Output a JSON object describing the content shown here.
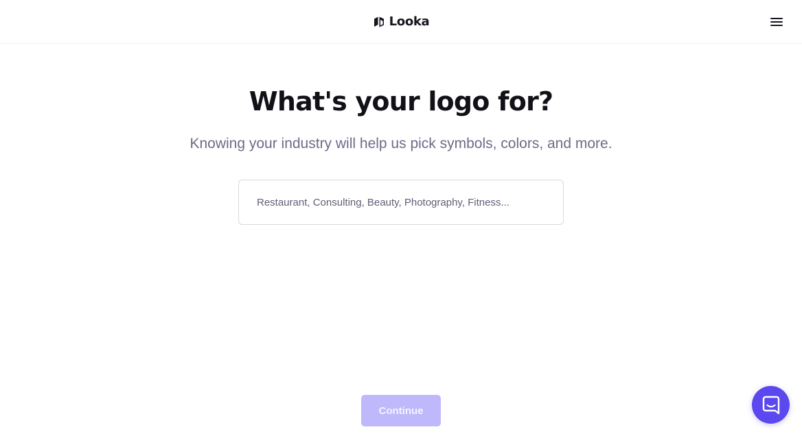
{
  "header": {
    "brand_name": "Looka",
    "logo_icon": "looka-logo-icon",
    "menu_icon": "hamburger-menu-icon"
  },
  "main": {
    "title": "What's your logo for?",
    "subtitle": "Knowing your industry will help us pick symbols, colors, and more.",
    "industry_input": {
      "value": "",
      "placeholder": "Restaurant, Consulting, Beauty, Photography, Fitness..."
    },
    "continue_label": "Continue",
    "continue_disabled": true
  },
  "chat": {
    "icon": "chat-bubble-icon"
  },
  "colors": {
    "accent": "#5b48ee",
    "button_disabled_bg": "#bfb8fb",
    "title_text": "#111118",
    "subtitle_text": "#6b6c85"
  }
}
